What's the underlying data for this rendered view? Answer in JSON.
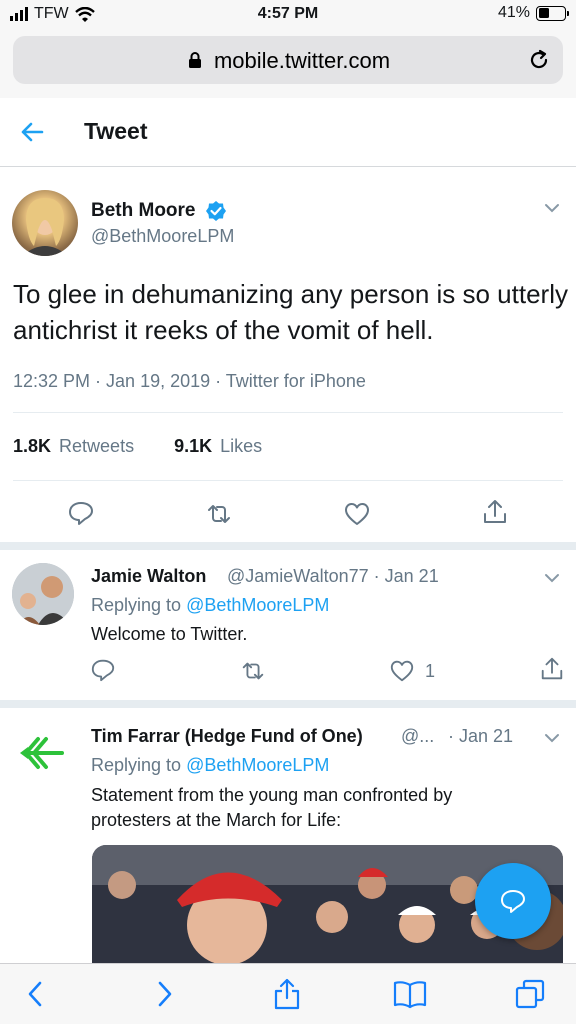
{
  "status_bar": {
    "carrier": "TFW",
    "time": "4:57 PM",
    "battery": "41%",
    "battery_level": 0.41
  },
  "address_bar": {
    "url": "mobile.twitter.com",
    "icons": [
      "lock-icon",
      "reload-icon"
    ]
  },
  "header": {
    "title": "Tweet",
    "back_icon": "back-arrow-icon"
  },
  "tweet": {
    "name": "Beth Moore",
    "handle": "@BethMooreLPM",
    "text": "To glee in dehumanizing any person is so utterly antichrist it reeks of the vomit of hell.",
    "meta": "12:32 PM · Jan 19, 2019 · Twitter for iPhone",
    "retweets_count": "1.8K",
    "retweets_label": "Retweets",
    "likes_count": "9.1K",
    "likes_label": "Likes",
    "actions": [
      "reply-icon",
      "retweet-icon",
      "like-icon",
      "share-icon"
    ]
  },
  "replies": [
    {
      "name": "Jamie Walton",
      "handle": "@JamieWalton77 · Jan 21",
      "replying_prefix": "Replying to ",
      "replying_to": "@BethMooreLPM",
      "text": "Welcome to Twitter.",
      "like_count": "1"
    },
    {
      "name": "Tim Farrar (Hedge Fund of One)",
      "handle": "@...",
      "date": "· Jan 21",
      "replying_prefix": "Replying to ",
      "replying_to": "@BethMooreLPM",
      "text": "Statement from the young man confronted by protesters at the March for Life:"
    }
  ],
  "colors": {
    "accent": "#1da1f2",
    "secondary_text": "#657786",
    "divider": "#e6ecf0"
  },
  "toolbar": {
    "icons": [
      "back-icon",
      "forward-icon",
      "share-icon",
      "bookmarks-icon",
      "tabs-icon"
    ]
  }
}
